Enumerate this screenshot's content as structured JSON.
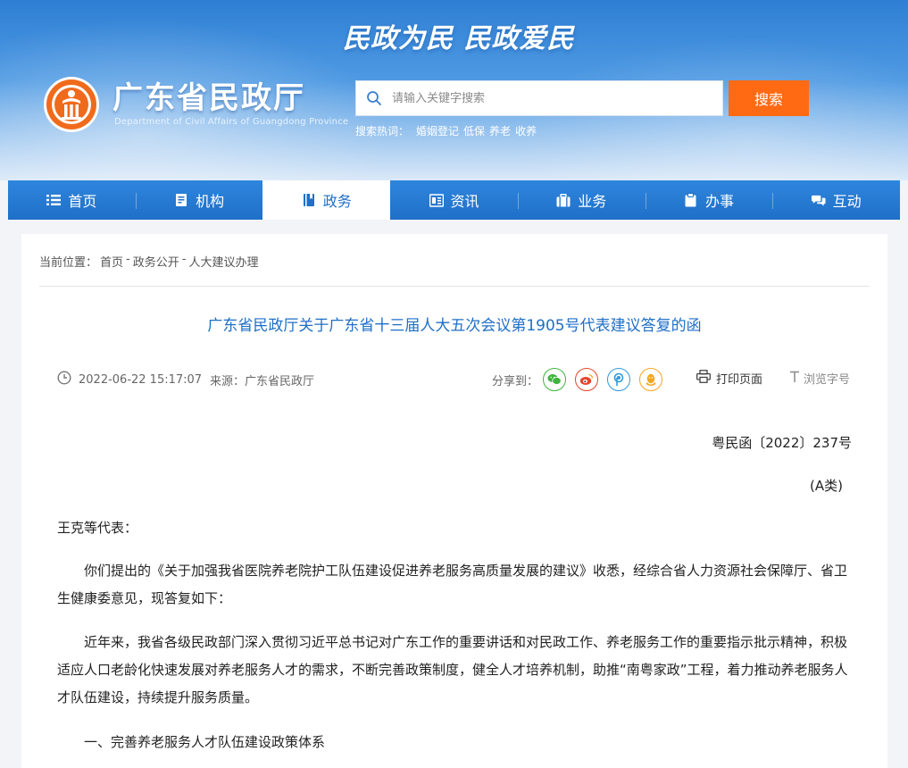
{
  "header": {
    "slogan": "民政为民  民政爱民",
    "site_title": "广东省民政厅",
    "site_subtitle": "Department of Civil Affairs of Guangdong Province",
    "search": {
      "placeholder": "请输入关键字搜索",
      "value": "",
      "button_label": "搜索"
    },
    "hot_label": "搜索热词：",
    "hot_words": [
      "婚姻登记",
      "低保",
      "养老",
      "收养"
    ]
  },
  "nav": {
    "items": [
      {
        "label": "首页",
        "icon": "list-icon"
      },
      {
        "label": "机构",
        "icon": "building-icon"
      },
      {
        "label": "政务",
        "icon": "book-icon"
      },
      {
        "label": "资讯",
        "icon": "news-icon"
      },
      {
        "label": "业务",
        "icon": "briefcase-icon"
      },
      {
        "label": "办事",
        "icon": "clipboard-icon"
      },
      {
        "label": "互动",
        "icon": "chat-icon"
      }
    ],
    "active_index": 2
  },
  "breadcrumb": {
    "prefix": "当前位置：",
    "items": [
      "首页",
      "政务公开",
      "人大建议办理"
    ],
    "separator": " - "
  },
  "article": {
    "title": "广东省民政厅关于广东省十三届人大五次会议第1905号代表建议答复的函",
    "time": "2022-06-22 15:17:07",
    "source": "来源：广东省民政厅",
    "share_label": "分享到：",
    "share_targets": [
      {
        "name": "wechat-share-icon",
        "color": "#3fb33f"
      },
      {
        "name": "weibo-share-icon",
        "color": "#e6452b"
      },
      {
        "name": "qzone-share-icon",
        "color": "#2f9bd8"
      },
      {
        "name": "qq-share-icon",
        "color": "#f5a623"
      }
    ],
    "print_label": "打印页面",
    "font_label": "浏览字号",
    "doc_number": "粤民函〔2022〕237号",
    "doc_class": "(A类)",
    "salutation": "王克等代表：",
    "p1": "你们提出的《关于加强我省医院养老院护工队伍建设促进养老服务高质量发展的建议》收悉，经综合省人力资源社会保障厅、省卫生健康委意见，现答复如下：",
    "p2": "近年来，我省各级民政部门深入贯彻习近平总书记对广东工作的重要讲话和对民政工作、养老服务工作的重要指示批示精神，积极适应人口老龄化快速发展对养老服务人才的需求，不断完善政策制度，健全人才培养机制，助推“南粤家政”工程，着力推动养老服务人才队伍建设，持续提升服务质量。",
    "section1": "一、完善养老服务人才队伍建设政策体系"
  },
  "colors": {
    "nav_blue": "#1f6fc7",
    "search_orange": "#ff6a13",
    "logo_orange": "#f06a1c"
  }
}
